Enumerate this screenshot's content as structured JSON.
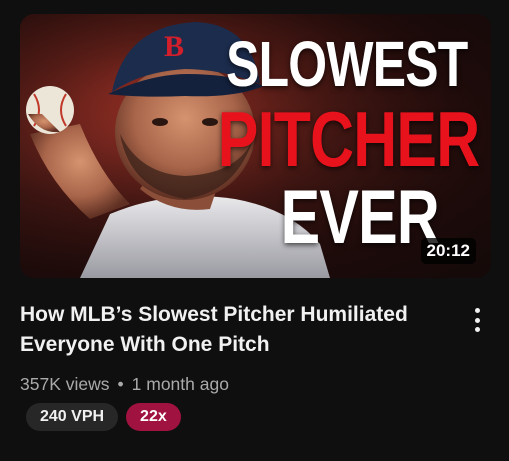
{
  "thumbnail": {
    "overlay_line1": "SLOWEST",
    "overlay_line2": "PITCHER",
    "overlay_line3": "EVER",
    "duration": "20:12",
    "cap_logo": "B",
    "overlay_colors": {
      "white": "#ffffff",
      "red": "#e8121c"
    }
  },
  "video": {
    "title": "How MLB’s Slowest Pitcher Humiliated Everyone With One Pitch",
    "views": "357K views",
    "separator": "•",
    "age": "1 month ago"
  },
  "badges": {
    "vph": "240 VPH",
    "multiplier": "22x",
    "colors": {
      "vph_bg": "#272727",
      "multiplier_bg": "#a0123f"
    }
  },
  "icons": {
    "more": "more-vertical-icon"
  }
}
